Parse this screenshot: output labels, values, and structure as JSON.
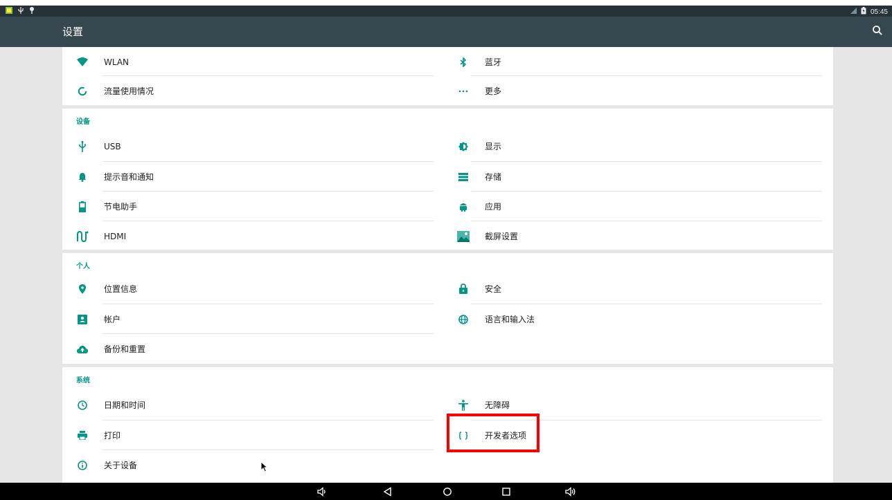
{
  "status_bar": {
    "time": "05:45"
  },
  "app_bar": {
    "title": "设置"
  },
  "wireless": {
    "left": [
      {
        "label": "WLAN",
        "icon": "wifi-icon"
      },
      {
        "label": "流量使用情况",
        "icon": "data-usage-icon"
      }
    ],
    "right": [
      {
        "label": "蓝牙",
        "icon": "bluetooth-icon"
      },
      {
        "label": "更多",
        "icon": "more-icon"
      }
    ]
  },
  "device": {
    "header": "设备",
    "left": [
      {
        "label": "USB",
        "icon": "usb-icon"
      },
      {
        "label": "提示音和通知",
        "icon": "bell-icon"
      },
      {
        "label": "节电助手",
        "icon": "battery-icon"
      },
      {
        "label": "HDMI",
        "icon": "hdmi-icon"
      }
    ],
    "right": [
      {
        "label": "显示",
        "icon": "brightness-icon"
      },
      {
        "label": "存储",
        "icon": "storage-icon"
      },
      {
        "label": "应用",
        "icon": "android-icon"
      },
      {
        "label": "截屏设置",
        "icon": "screenshot-icon"
      }
    ]
  },
  "personal": {
    "header": "个人",
    "left": [
      {
        "label": "位置信息",
        "icon": "location-icon"
      },
      {
        "label": "帐户",
        "icon": "account-icon"
      },
      {
        "label": "备份和重置",
        "icon": "cloud-upload-icon"
      }
    ],
    "right": [
      {
        "label": "安全",
        "icon": "lock-icon"
      },
      {
        "label": "语言和输入法",
        "icon": "globe-icon"
      }
    ]
  },
  "system": {
    "header": "系统",
    "left": [
      {
        "label": "日期和时间",
        "icon": "clock-icon"
      },
      {
        "label": "打印",
        "icon": "print-icon"
      },
      {
        "label": "关于设备",
        "icon": "info-icon"
      }
    ],
    "right": [
      {
        "label": "无障碍",
        "icon": "accessibility-icon"
      },
      {
        "label": "开发者选项",
        "icon": "braces-icon"
      }
    ]
  },
  "colors": {
    "accent": "#009688",
    "status_bar": "#263238",
    "app_bar": "#37474f",
    "highlight": "#ff0000"
  },
  "nav_bar": {
    "buttons": [
      "volume-down-icon",
      "back-icon",
      "home-icon",
      "recents-icon",
      "volume-up-icon"
    ]
  }
}
